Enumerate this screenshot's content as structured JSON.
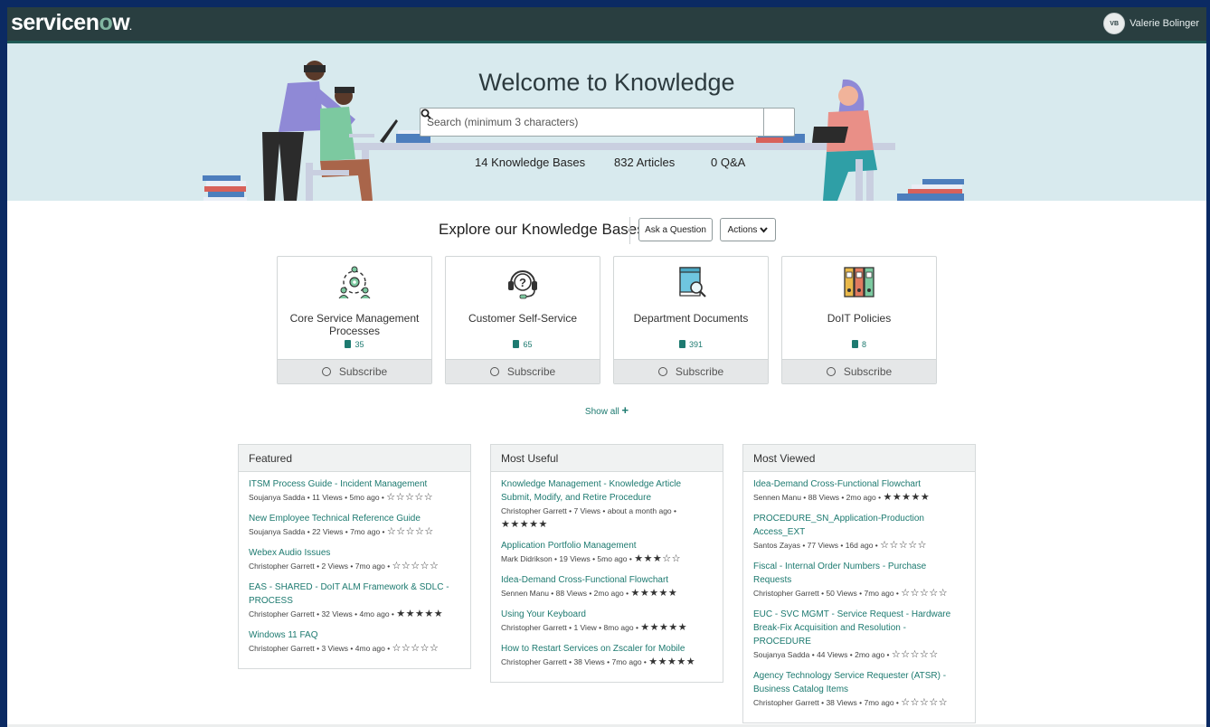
{
  "header": {
    "logo_pre": "servicen",
    "logo_o": "o",
    "logo_post": "w",
    "logo_mark": ".",
    "user_initials": "VB",
    "user_name": "Valerie Bolinger"
  },
  "hero": {
    "title": "Welcome to Knowledge",
    "search_placeholder": "Search (minimum 3 characters)",
    "stats": [
      "14 Knowledge Bases",
      "832 Articles",
      "0 Q&A"
    ]
  },
  "explore": {
    "title": "Explore our Knowledge Bases",
    "ask_label": "Ask a Question",
    "actions_label": "Actions",
    "show_all": "Show all",
    "subscribe_label": "Subscribe",
    "cards": [
      {
        "name": "Core Service Management Processes",
        "count": "35",
        "icon": "people-gear-icon"
      },
      {
        "name": "Customer Self-Service",
        "count": "65",
        "icon": "headset-question-icon"
      },
      {
        "name": "Department Documents",
        "count": "391",
        "icon": "book-search-icon"
      },
      {
        "name": "DoIT Policies",
        "count": "8",
        "icon": "binders-icon"
      }
    ]
  },
  "panels": [
    {
      "title": "Featured",
      "items": [
        {
          "title": "ITSM Process Guide - Incident Management",
          "author": "Soujanya Sadda",
          "views": "11 Views",
          "age": "5mo ago",
          "rating": 0
        },
        {
          "title": "New Employee Technical Reference Guide",
          "author": "Soujanya Sadda",
          "views": "22 Views",
          "age": "7mo ago",
          "rating": 0
        },
        {
          "title": "Webex Audio Issues",
          "author": "Christopher Garrett",
          "views": "2 Views",
          "age": "7mo ago",
          "rating": 0
        },
        {
          "title": "EAS - SHARED - DoIT ALM Framework & SDLC - PROCESS",
          "author": "Christopher Garrett",
          "views": "32 Views",
          "age": "4mo ago",
          "rating": 5
        },
        {
          "title": "Windows 11 FAQ",
          "author": "Christopher Garrett",
          "views": "3 Views",
          "age": "4mo ago",
          "rating": 0
        }
      ]
    },
    {
      "title": "Most Useful",
      "items": [
        {
          "title": "Knowledge Management - Knowledge Article Submit, Modify, and Retire Procedure",
          "author": "Christopher Garrett",
          "views": "7 Views",
          "age": "about a month ago",
          "rating": 5
        },
        {
          "title": "Application Portfolio Management",
          "author": "Mark Didrikson",
          "views": "19 Views",
          "age": "5mo ago",
          "rating": 3
        },
        {
          "title": "Idea-Demand Cross-Functional Flowchart",
          "author": "Sennen Manu",
          "views": "88 Views",
          "age": "2mo ago",
          "rating": 5
        },
        {
          "title": "Using Your Keyboard",
          "author": "Christopher Garrett",
          "views": "1 View",
          "age": "8mo ago",
          "rating": 5
        },
        {
          "title": "How to Restart Services on Zscaler for Mobile",
          "author": "Christopher Garrett",
          "views": "38 Views",
          "age": "7mo ago",
          "rating": 5
        }
      ]
    },
    {
      "title": "Most Viewed",
      "items": [
        {
          "title": "Idea-Demand Cross-Functional Flowchart",
          "author": "Sennen Manu",
          "views": "88 Views",
          "age": "2mo ago",
          "rating": 5
        },
        {
          "title": "PROCEDURE_SN_Application-Production Access_EXT",
          "author": "Santos Zayas",
          "views": "77 Views",
          "age": "16d ago",
          "rating": 0
        },
        {
          "title": "Fiscal - Internal Order Numbers - Purchase Requests",
          "author": "Christopher Garrett",
          "views": "50 Views",
          "age": "7mo ago",
          "rating": 0
        },
        {
          "title": "EUC - SVC MGMT - Service Request - Hardware Break-Fix Acquisition and Resolution - PROCEDURE",
          "author": "Soujanya Sadda",
          "views": "44 Views",
          "age": "2mo ago",
          "rating": 0
        },
        {
          "title": "Agency Technology Service Requester (ATSR) - Business Catalog Items",
          "author": "Christopher Garrett",
          "views": "38 Views",
          "age": "7mo ago",
          "rating": 0
        }
      ]
    }
  ]
}
